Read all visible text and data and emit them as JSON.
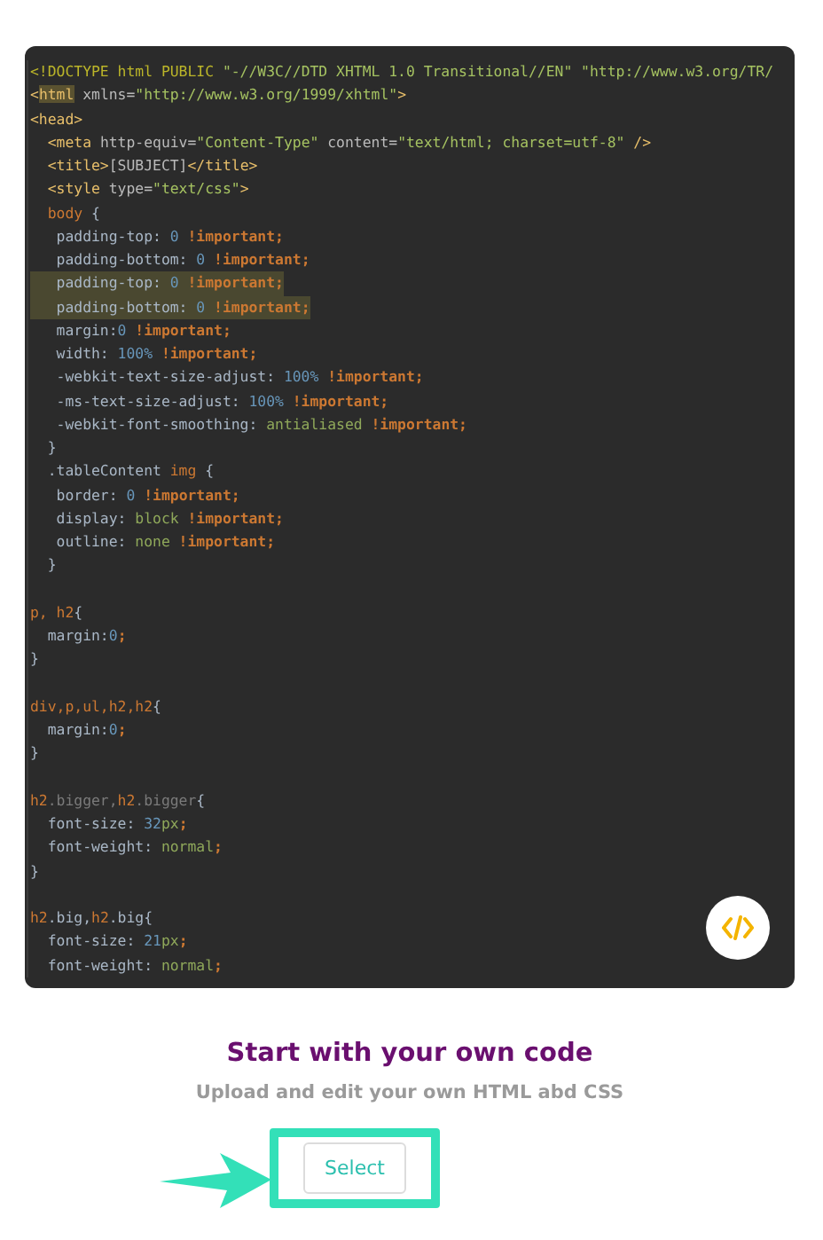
{
  "code_lines": [
    {
      "kind": "code",
      "highlighted": false,
      "segments": [
        {
          "text": "<!DOCTYPE html PUBLIC ",
          "kind": "doctype"
        },
        {
          "text": "\"-//W3C//DTD XHTML 1.0 Transitional//EN\" \"http://www.w3.org/TR/",
          "kind": "str"
        }
      ]
    },
    {
      "kind": "code",
      "highlighted": false,
      "segments": [
        {
          "text": "<",
          "kind": "tag"
        },
        {
          "text": "html",
          "kind": "match"
        },
        {
          "text": " xmlns=",
          "kind": "attr"
        },
        {
          "text": "\"http://www.w3.org/1999/xhtml\"",
          "kind": "str"
        },
        {
          "text": ">",
          "kind": "tag"
        }
      ]
    },
    {
      "kind": "code",
      "highlighted": false,
      "segments": [
        {
          "text": "<head>",
          "kind": "tag"
        }
      ]
    },
    {
      "kind": "code",
      "highlighted": false,
      "segments": [
        {
          "text": "  <meta",
          "kind": "tag"
        },
        {
          "text": " http-equiv=",
          "kind": "attr"
        },
        {
          "text": "\"Content-Type\"",
          "kind": "str"
        },
        {
          "text": " content=",
          "kind": "attr"
        },
        {
          "text": "\"text/html; charset=utf-8\"",
          "kind": "str"
        },
        {
          "text": " />",
          "kind": "tag"
        }
      ]
    },
    {
      "kind": "code",
      "highlighted": false,
      "segments": [
        {
          "text": "  <title>",
          "kind": "tag"
        },
        {
          "text": "[SUBJECT]",
          "kind": "attr"
        },
        {
          "text": "</title>",
          "kind": "tag"
        }
      ]
    },
    {
      "kind": "code",
      "highlighted": false,
      "segments": [
        {
          "text": "  <style",
          "kind": "tag"
        },
        {
          "text": " type=",
          "kind": "attr"
        },
        {
          "text": "\"text/css\"",
          "kind": "str"
        },
        {
          "text": ">",
          "kind": "tag"
        }
      ]
    },
    {
      "kind": "code",
      "highlighted": false,
      "segments": [
        {
          "text": "  body",
          "kind": "sel"
        },
        {
          "text": " {",
          "kind": "punc"
        }
      ]
    },
    {
      "kind": "code",
      "highlighted": false,
      "segments": [
        {
          "text": "   padding-top: ",
          "kind": "prop"
        },
        {
          "text": "0",
          "kind": "num"
        },
        {
          "text": " !important;",
          "kind": "kw"
        }
      ]
    },
    {
      "kind": "code",
      "highlighted": false,
      "segments": [
        {
          "text": "   padding-bottom: ",
          "kind": "prop"
        },
        {
          "text": "0",
          "kind": "num"
        },
        {
          "text": " !important;",
          "kind": "kw"
        }
      ]
    },
    {
      "kind": "code",
      "highlighted": true,
      "segments": [
        {
          "text": "   padding-top: ",
          "kind": "prop"
        },
        {
          "text": "0",
          "kind": "num"
        },
        {
          "text": " !important;",
          "kind": "kw"
        }
      ]
    },
    {
      "kind": "code",
      "highlighted": true,
      "segments": [
        {
          "text": "   padding-bottom: ",
          "kind": "prop"
        },
        {
          "text": "0",
          "kind": "num"
        },
        {
          "text": " !important;",
          "kind": "kw"
        }
      ]
    },
    {
      "kind": "code",
      "highlighted": false,
      "segments": [
        {
          "text": "   margin:",
          "kind": "prop"
        },
        {
          "text": "0",
          "kind": "num"
        },
        {
          "text": " !important;",
          "kind": "kw"
        }
      ]
    },
    {
      "kind": "code",
      "highlighted": false,
      "segments": [
        {
          "text": "   width: ",
          "kind": "prop"
        },
        {
          "text": "100%",
          "kind": "num"
        },
        {
          "text": " !important;",
          "kind": "kw"
        }
      ]
    },
    {
      "kind": "code",
      "highlighted": false,
      "segments": [
        {
          "text": "   -webkit-text-size-adjust: ",
          "kind": "prop"
        },
        {
          "text": "100%",
          "kind": "num"
        },
        {
          "text": " !important;",
          "kind": "kw"
        }
      ]
    },
    {
      "kind": "code",
      "highlighted": false,
      "segments": [
        {
          "text": "   -ms-text-size-adjust: ",
          "kind": "prop"
        },
        {
          "text": "100%",
          "kind": "num"
        },
        {
          "text": " !important;",
          "kind": "kw"
        }
      ]
    },
    {
      "kind": "code",
      "highlighted": false,
      "segments": [
        {
          "text": "   -webkit-font-smoothing: ",
          "kind": "prop"
        },
        {
          "text": "antialiased",
          "kind": "val"
        },
        {
          "text": " !important;",
          "kind": "kw"
        }
      ]
    },
    {
      "kind": "code",
      "highlighted": false,
      "segments": [
        {
          "text": "  }",
          "kind": "punc"
        }
      ]
    },
    {
      "kind": "code",
      "highlighted": false,
      "segments": [
        {
          "text": "  .tableContent",
          "kind": "prop"
        },
        {
          "text": " img",
          "kind": "sel"
        },
        {
          "text": " {",
          "kind": "punc"
        }
      ]
    },
    {
      "kind": "code",
      "highlighted": false,
      "segments": [
        {
          "text": "   border: ",
          "kind": "prop"
        },
        {
          "text": "0",
          "kind": "num"
        },
        {
          "text": " !important;",
          "kind": "kw"
        }
      ]
    },
    {
      "kind": "code",
      "highlighted": false,
      "segments": [
        {
          "text": "   display: ",
          "kind": "prop"
        },
        {
          "text": "block",
          "kind": "val"
        },
        {
          "text": " !important;",
          "kind": "kw"
        }
      ]
    },
    {
      "kind": "code",
      "highlighted": false,
      "segments": [
        {
          "text": "   outline: ",
          "kind": "prop"
        },
        {
          "text": "none",
          "kind": "val"
        },
        {
          "text": " !important;",
          "kind": "kw"
        }
      ]
    },
    {
      "kind": "code",
      "highlighted": false,
      "segments": [
        {
          "text": "  }",
          "kind": "punc"
        }
      ]
    },
    {
      "kind": "blank"
    },
    {
      "kind": "code",
      "highlighted": false,
      "segments": [
        {
          "text": "p, h2",
          "kind": "sel"
        },
        {
          "text": "{",
          "kind": "punc"
        }
      ]
    },
    {
      "kind": "code",
      "highlighted": false,
      "segments": [
        {
          "text": "  margin:",
          "kind": "prop"
        },
        {
          "text": "0",
          "kind": "num"
        },
        {
          "text": ";",
          "kind": "kw"
        }
      ]
    },
    {
      "kind": "code",
      "highlighted": false,
      "segments": [
        {
          "text": "}",
          "kind": "punc"
        }
      ]
    },
    {
      "kind": "blank"
    },
    {
      "kind": "code",
      "highlighted": false,
      "segments": [
        {
          "text": "div,p,ul,h2,h2",
          "kind": "sel"
        },
        {
          "text": "{",
          "kind": "punc"
        }
      ]
    },
    {
      "kind": "code",
      "highlighted": false,
      "segments": [
        {
          "text": "  margin:",
          "kind": "prop"
        },
        {
          "text": "0",
          "kind": "num"
        },
        {
          "text": ";",
          "kind": "kw"
        }
      ]
    },
    {
      "kind": "code",
      "highlighted": false,
      "segments": [
        {
          "text": "}",
          "kind": "punc"
        }
      ]
    },
    {
      "kind": "blank"
    },
    {
      "kind": "code",
      "highlighted": false,
      "segments": [
        {
          "text": "h2",
          "kind": "sel"
        },
        {
          "text": ".bigger,",
          "kind": "dim"
        },
        {
          "text": "h2",
          "kind": "sel"
        },
        {
          "text": ".bigger",
          "kind": "dim"
        },
        {
          "text": "{",
          "kind": "punc"
        }
      ]
    },
    {
      "kind": "code",
      "highlighted": false,
      "segments": [
        {
          "text": "  font-size: ",
          "kind": "prop"
        },
        {
          "text": "32",
          "kind": "num"
        },
        {
          "text": "px",
          "kind": "val"
        },
        {
          "text": ";",
          "kind": "kw"
        }
      ]
    },
    {
      "kind": "code",
      "highlighted": false,
      "segments": [
        {
          "text": "  font-weight: ",
          "kind": "prop"
        },
        {
          "text": "normal",
          "kind": "val"
        },
        {
          "text": ";",
          "kind": "kw"
        }
      ]
    },
    {
      "kind": "code",
      "highlighted": false,
      "segments": [
        {
          "text": "}",
          "kind": "punc"
        }
      ]
    },
    {
      "kind": "blank"
    },
    {
      "kind": "code",
      "highlighted": false,
      "segments": [
        {
          "text": "h2",
          "kind": "sel"
        },
        {
          "text": ".big,",
          "kind": "prop"
        },
        {
          "text": "h2",
          "kind": "sel"
        },
        {
          "text": ".big",
          "kind": "prop"
        },
        {
          "text": "{",
          "kind": "punc"
        }
      ]
    },
    {
      "kind": "code",
      "highlighted": false,
      "segments": [
        {
          "text": "  font-size: ",
          "kind": "prop"
        },
        {
          "text": "21",
          "kind": "num"
        },
        {
          "text": "px",
          "kind": "val"
        },
        {
          "text": ";",
          "kind": "kw"
        }
      ]
    },
    {
      "kind": "code",
      "highlighted": false,
      "segments": [
        {
          "text": "  font-weight: ",
          "kind": "prop"
        },
        {
          "text": "normal",
          "kind": "val"
        },
        {
          "text": ";",
          "kind": "kw"
        }
      ]
    }
  ],
  "title": "Start with your own code",
  "subtitle": "Upload and edit your own HTML abd CSS",
  "select_button": {
    "label": "Select"
  }
}
